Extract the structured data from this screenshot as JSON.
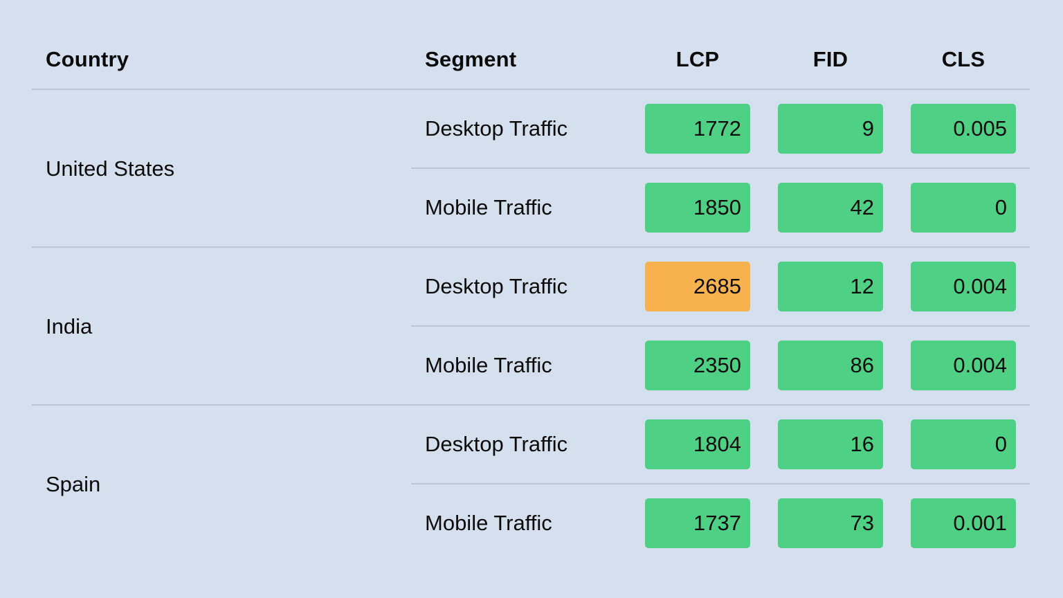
{
  "columns": {
    "country": "Country",
    "segment": "Segment",
    "lcp": "LCP",
    "fid": "FID",
    "cls": "CLS"
  },
  "colors": {
    "good": "#4ed184",
    "needs_improvement": "#f7b24e",
    "background": "#d4e0ee"
  },
  "groups": [
    {
      "country": "United States",
      "segments": [
        {
          "label": "Desktop Traffic",
          "lcp": "1772",
          "lcp_status": "good",
          "fid": "9",
          "fid_status": "good",
          "cls": "0.005",
          "cls_status": "good"
        },
        {
          "label": "Mobile Traffic",
          "lcp": "1850",
          "lcp_status": "good",
          "fid": "42",
          "fid_status": "good",
          "cls": "0",
          "cls_status": "good"
        }
      ]
    },
    {
      "country": "India",
      "segments": [
        {
          "label": "Desktop Traffic",
          "lcp": "2685",
          "lcp_status": "needs_improvement",
          "fid": "12",
          "fid_status": "good",
          "cls": "0.004",
          "cls_status": "good"
        },
        {
          "label": "Mobile Traffic",
          "lcp": "2350",
          "lcp_status": "good",
          "fid": "86",
          "fid_status": "good",
          "cls": "0.004",
          "cls_status": "good"
        }
      ]
    },
    {
      "country": "Spain",
      "segments": [
        {
          "label": "Desktop Traffic",
          "lcp": "1804",
          "lcp_status": "good",
          "fid": "16",
          "fid_status": "good",
          "cls": "0",
          "cls_status": "good"
        },
        {
          "label": "Mobile Traffic",
          "lcp": "1737",
          "lcp_status": "good",
          "fid": "73",
          "fid_status": "good",
          "cls": "0.001",
          "cls_status": "good"
        }
      ]
    }
  ]
}
